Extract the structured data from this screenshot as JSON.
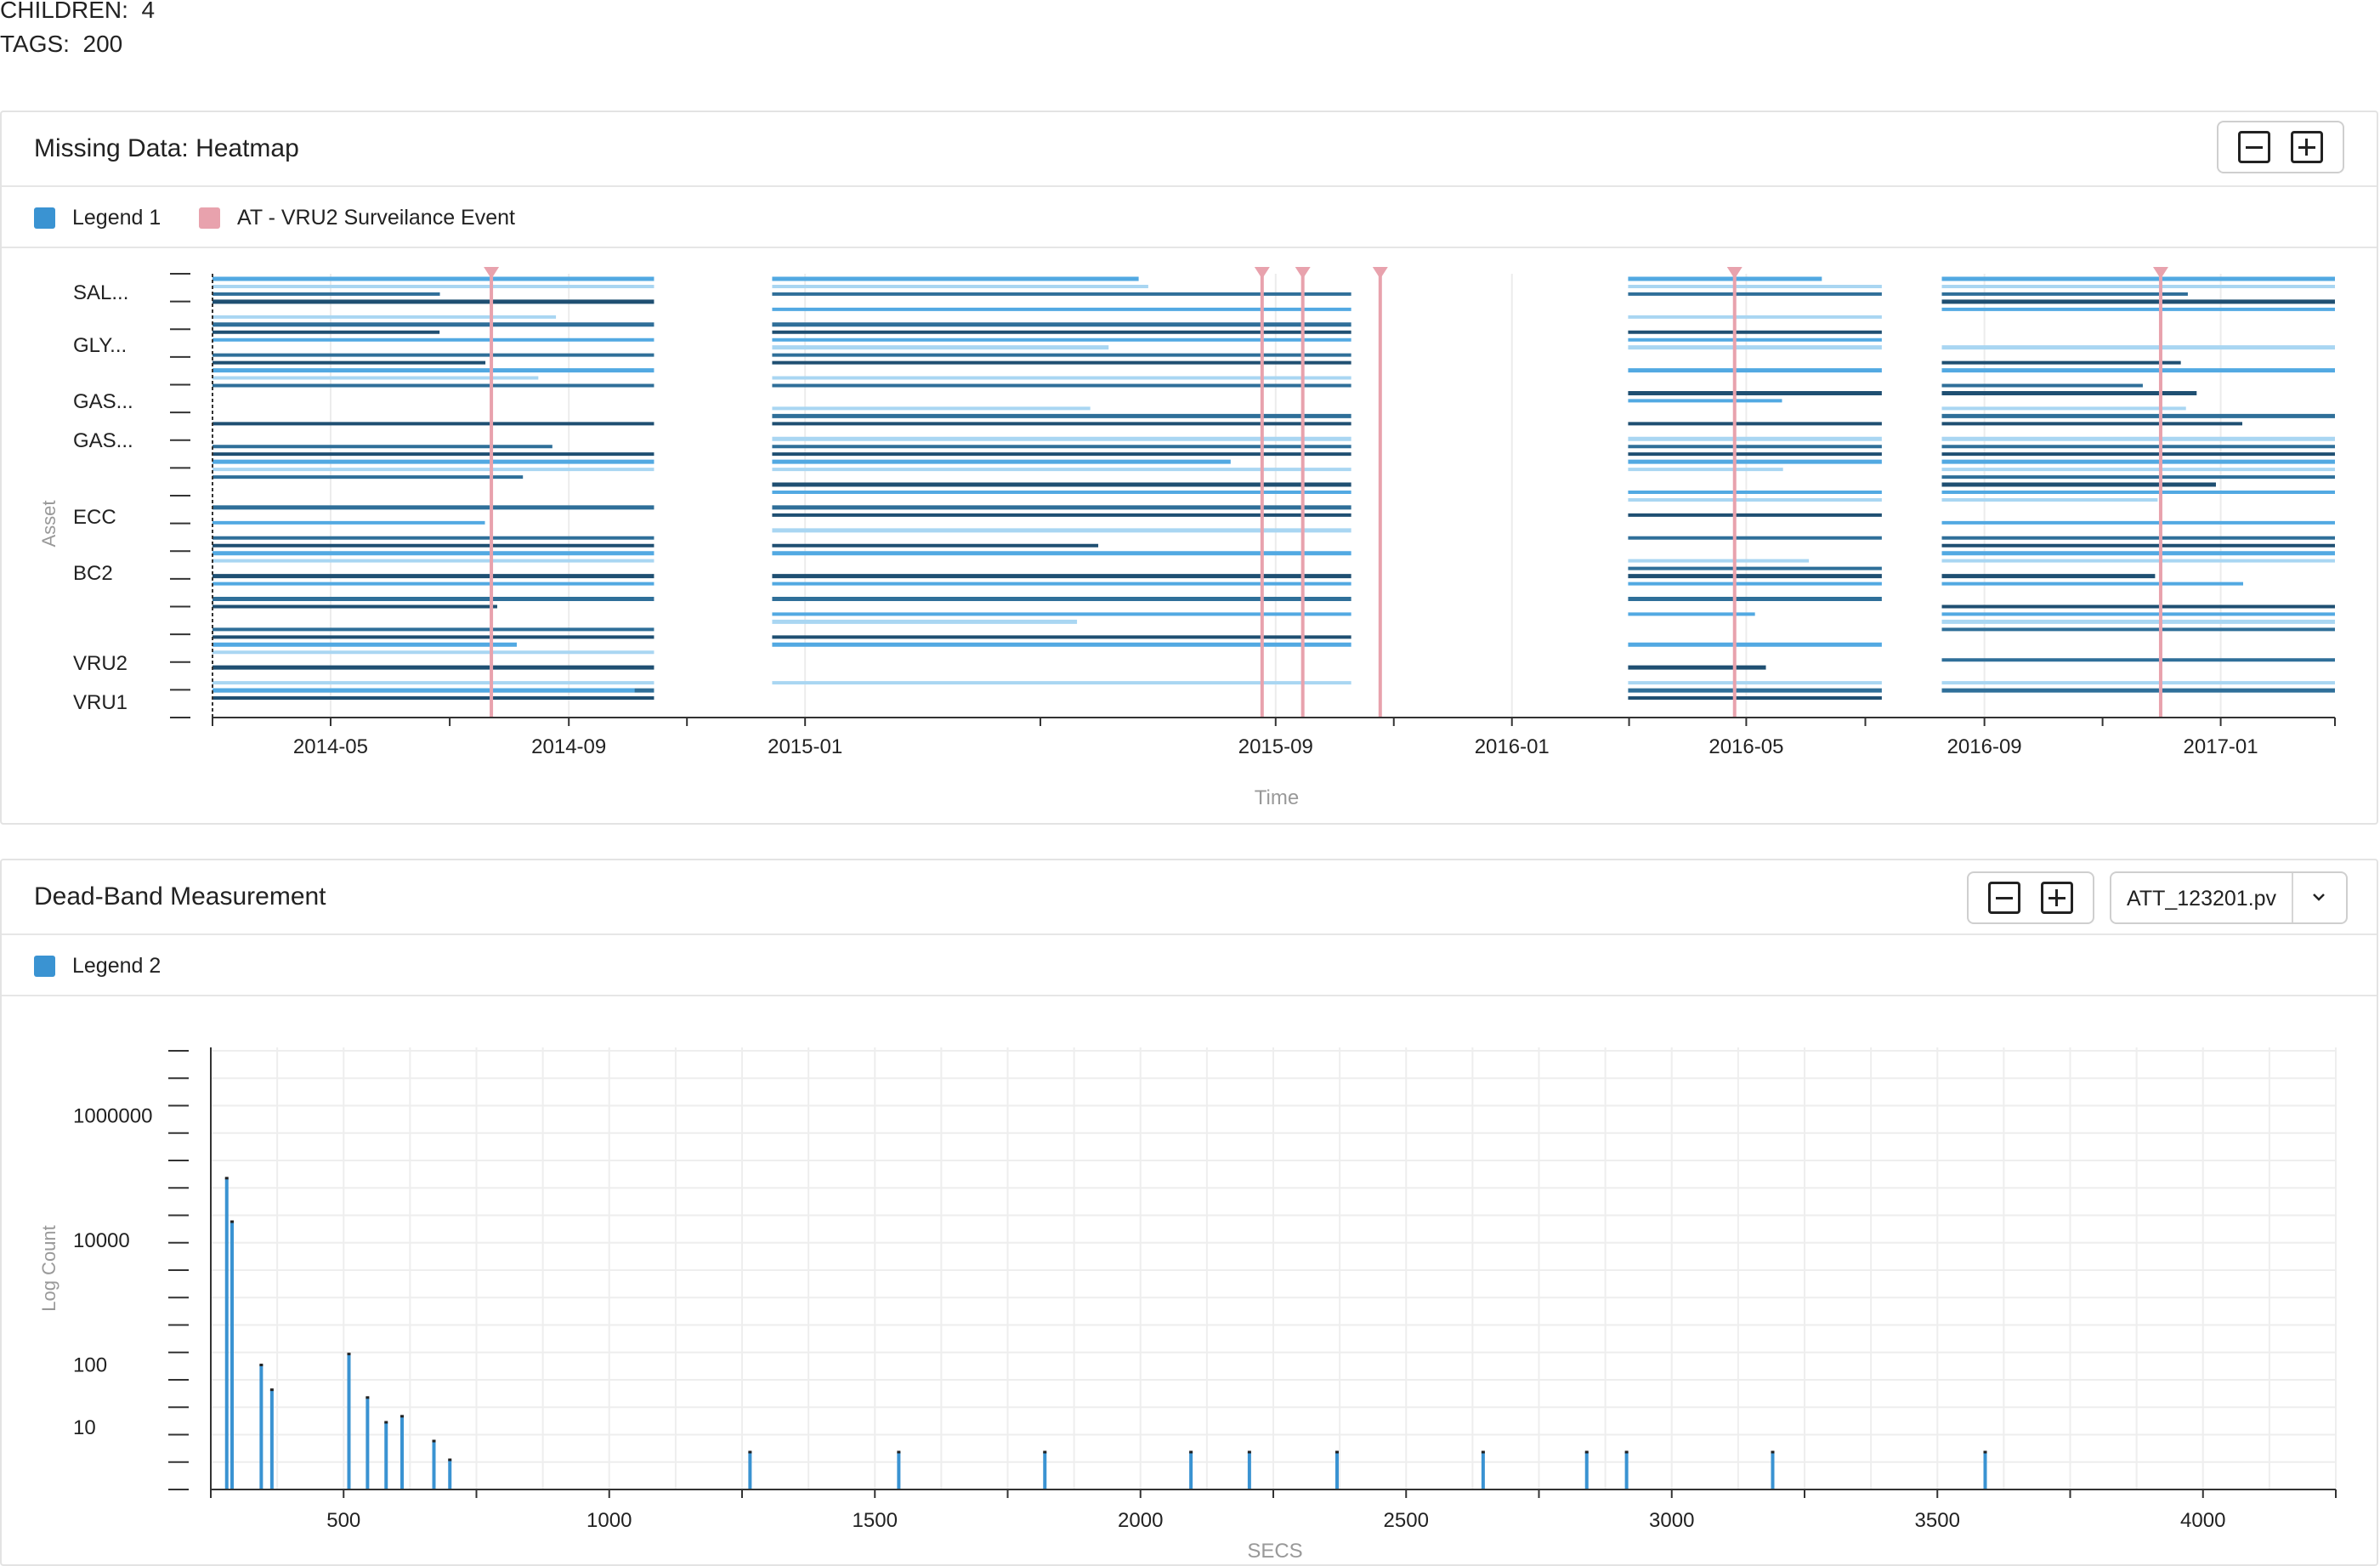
{
  "meta": {
    "children_label": "CHILDREN:",
    "children_value": "4",
    "tags_label": "TAGS:",
    "tags_value": "200"
  },
  "heatmap_panel": {
    "title": "Missing Data: Heatmap",
    "zoom_out_icon": "minus-square-icon",
    "zoom_in_icon": "plus-square-icon",
    "legend": [
      {
        "label": "Legend 1",
        "color": "#3a93d2"
      },
      {
        "label": "AT - VRU2 Surveilance Event",
        "color": "#e8a2ad"
      }
    ]
  },
  "deadband_panel": {
    "title": "Dead-Band Measurement",
    "selected_tag": "ATT_123201.pv",
    "dropdown_icon": "chevron-down-icon",
    "legend": [
      {
        "label": "Legend 2",
        "color": "#3a93d2"
      }
    ]
  },
  "chart_data": [
    {
      "type": "heatmap",
      "title": "",
      "xlabel": "Time",
      "ylabel": "Asset",
      "x_tick_labels": [
        "2014-05",
        "2014-09",
        "2015-01",
        "2015-09",
        "2016-01",
        "2016-05",
        "2016-09",
        "2017-01"
      ],
      "x_tick_dates": [
        "2014-05-01",
        "2014-09-01",
        "2015-01-01",
        "2015-09-01",
        "2016-01-01",
        "2016-05-01",
        "2016-09-01",
        "2017-01-01"
      ],
      "xlim": [
        "2014-03-01",
        "2017-03-01"
      ],
      "y_labels": [
        "SAL...",
        "GLY...",
        "GAS...",
        "GAS...",
        "ECC",
        "BC2",
        "VRU2",
        "VRU1"
      ],
      "series_color_palette": [
        "#a9d6f2",
        "#52a9e2",
        "#2f6f99",
        "#1f4f72"
      ],
      "gaps_dates": [
        [
          "2014-10-15",
          "2014-12-15"
        ],
        [
          "2015-10-10",
          "2016-03-01"
        ],
        [
          "2016-07-10",
          "2016-08-10"
        ]
      ],
      "events": {
        "name": "AT - VRU2 Surveilance Event",
        "dates": [
          "2014-07-23",
          "2015-08-25",
          "2015-09-15",
          "2015-10-25",
          "2016-04-25",
          "2016-12-01"
        ]
      }
    },
    {
      "type": "bar",
      "title": "",
      "xlabel": "SECS",
      "ylabel": "Log Count",
      "y_scale": "log",
      "x_ticks": [
        500,
        1000,
        1500,
        2000,
        2500,
        3000,
        3500,
        4000
      ],
      "y_tick_labels": [
        10,
        100,
        10000,
        1000000
      ],
      "xlim": [
        250,
        4250
      ],
      "points": [
        {
          "x": 280,
          "y": 100000
        },
        {
          "x": 290,
          "y": 20000
        },
        {
          "x": 345,
          "y": 100
        },
        {
          "x": 365,
          "y": 40
        },
        {
          "x": 510,
          "y": 150
        },
        {
          "x": 545,
          "y": 30
        },
        {
          "x": 580,
          "y": 12
        },
        {
          "x": 610,
          "y": 15
        },
        {
          "x": 670,
          "y": 6
        },
        {
          "x": 700,
          "y": 3
        },
        {
          "x": 1265,
          "y": 1
        },
        {
          "x": 1545,
          "y": 1
        },
        {
          "x": 1820,
          "y": 1
        },
        {
          "x": 2095,
          "y": 1
        },
        {
          "x": 2205,
          "y": 1
        },
        {
          "x": 2370,
          "y": 1
        },
        {
          "x": 2645,
          "y": 1
        },
        {
          "x": 2840,
          "y": 1
        },
        {
          "x": 2915,
          "y": 1
        },
        {
          "x": 3190,
          "y": 1
        },
        {
          "x": 3590,
          "y": 1
        }
      ],
      "color": "#3a93d2"
    }
  ]
}
